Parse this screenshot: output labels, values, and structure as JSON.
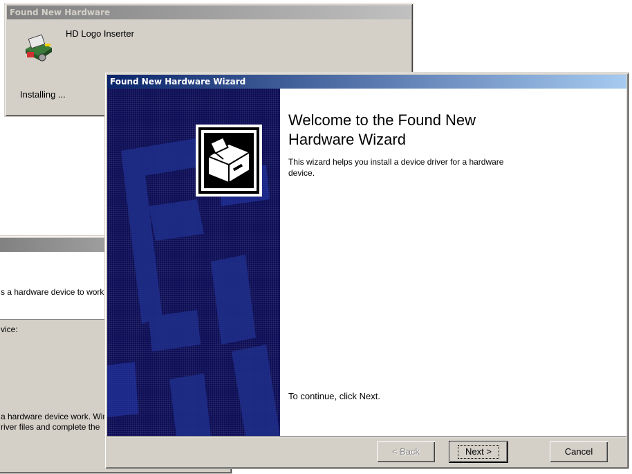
{
  "window1": {
    "title": "Found New Hardware",
    "device_name": "HD Logo Inserter",
    "status": "Installing ..."
  },
  "window3": {
    "header_text": "s a hardware device to work with",
    "line1": "vice:",
    "paragraph_line1": "a hardware device work. Windows",
    "paragraph_line2": "river files and complete the"
  },
  "wizard": {
    "title": "Found New Hardware Wizard",
    "heading": "Welcome to the Found New Hardware Wizard",
    "description": "This wizard helps you install a device driver for a hardware device.",
    "continue_text": "To continue, click Next.",
    "buttons": {
      "back": "< Back",
      "next": "Next >",
      "cancel": "Cancel"
    }
  },
  "colors": {
    "title_active_start": "#0a246a",
    "title_active_end": "#a6caf0",
    "title_inactive_start": "#808080",
    "title_inactive_end": "#c0c0c0",
    "window_face": "#d4d0c8",
    "wizard_panel": "#0d0d56"
  },
  "icons": {
    "device": "hardware-device-icon",
    "wizard": "hardware-wizard-icon"
  }
}
